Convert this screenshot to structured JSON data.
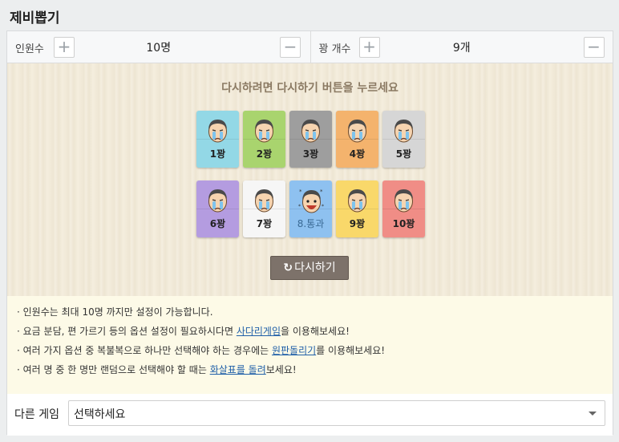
{
  "app": {
    "title": "제비뽑기"
  },
  "controls": {
    "people": {
      "label": "인원수",
      "value": "10명",
      "plus": "+",
      "minus": "−"
    },
    "winners": {
      "label": "꽝 개수",
      "value": "9개",
      "plus": "+",
      "minus": "−"
    }
  },
  "game": {
    "instruction": "다시하려면 다시하기 버튼을 누르세요",
    "cards": [
      {
        "label": "1꽝",
        "color": "#93d8e6",
        "state": "lose"
      },
      {
        "label": "2꽝",
        "color": "#a9d46e",
        "state": "lose"
      },
      {
        "label": "3꽝",
        "color": "#9e9e9e",
        "state": "lose"
      },
      {
        "label": "4꽝",
        "color": "#f4b36d",
        "state": "lose"
      },
      {
        "label": "5꽝",
        "color": "#d6d6d6",
        "state": "lose"
      },
      {
        "label": "6꽝",
        "color": "#b49ce0",
        "state": "lose"
      },
      {
        "label": "7꽝",
        "color": "#f6f6f6",
        "state": "lose"
      },
      {
        "label": "8.통과",
        "color": "#8ec1f0",
        "state": "pass"
      },
      {
        "label": "9꽝",
        "color": "#f9d86a",
        "state": "lose"
      },
      {
        "label": "10꽝",
        "color": "#f08d86",
        "state": "lose"
      }
    ],
    "retry_label": "다시하기",
    "retry_icon": "refresh-icon"
  },
  "notes": {
    "n1": {
      "text": "· 인원수는 최대 10명 까지만 설정이 가능합니다."
    },
    "n2": {
      "before": "· 요금 분담, 편 가르기 등의 옵션 설정이 필요하시다면 ",
      "link": "사다리게임",
      "after": "을 이용해보세요!"
    },
    "n3": {
      "before": "· 여러 가지 옵션 중 복불복으로 하나만 선택해야 하는 경우에는 ",
      "link": "원판돌리기",
      "after": "를 이용해보세요!"
    },
    "n4": {
      "before": "· 여러 명 중 한 명만 랜덤으로 선택해야 할 때는 ",
      "link": "화살표를 돌려",
      "after": "보세요!"
    }
  },
  "other_game": {
    "label": "다른 게임",
    "selected": "선택하세요"
  }
}
